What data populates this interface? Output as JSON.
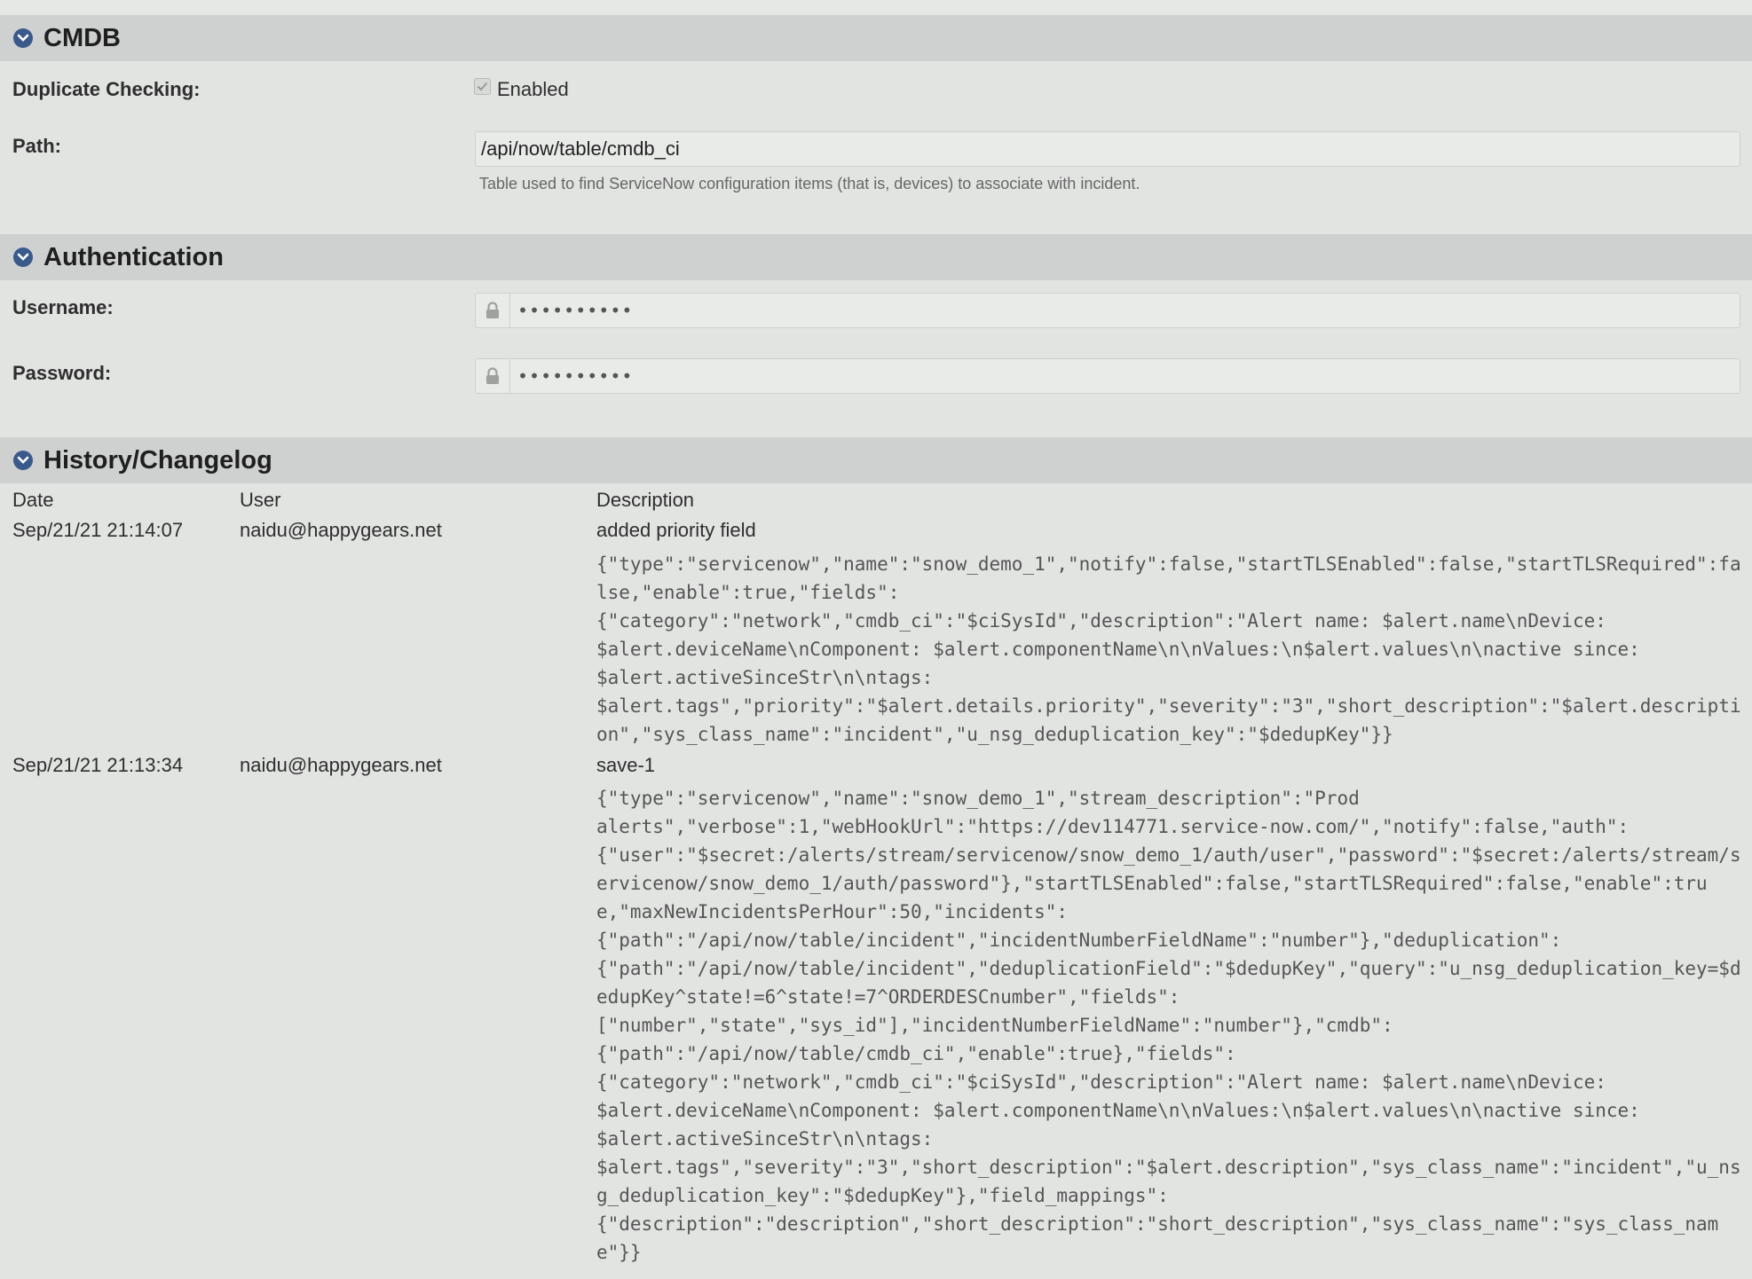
{
  "cmdb": {
    "title": "CMDB",
    "duplicate_label": "Duplicate Checking:",
    "duplicate_value": "Enabled",
    "path_label": "Path:",
    "path_value": "/api/now/table/cmdb_ci",
    "path_help": "Table used to find ServiceNow configuration items (that is, devices) to associate with incident."
  },
  "auth": {
    "title": "Authentication",
    "username_label": "Username:",
    "username_value": "••••••••••",
    "password_label": "Password:",
    "password_value": "••••••••••"
  },
  "history": {
    "title": "History/Changelog",
    "columns": {
      "date": "Date",
      "user": "User",
      "description": "Description"
    },
    "rows": [
      {
        "date": "Sep/21/21 21:14:07",
        "user": "naidu@happygears.net",
        "summary": "added priority field",
        "json": "{\"type\":\"servicenow\",\"name\":\"snow_demo_1\",\"notify\":false,\"startTLSEnabled\":false,\"startTLSRequired\":false,\"enable\":true,\"fields\":\n{\"category\":\"network\",\"cmdb_ci\":\"$ciSysId\",\"description\":\"Alert name: $alert.name\\nDevice:\n$alert.deviceName\\nComponent: $alert.componentName\\n\\nValues:\\n$alert.values\\n\\nactive since:\n$alert.activeSinceStr\\n\\ntags:\n$alert.tags\",\"priority\":\"$alert.details.priority\",\"severity\":\"3\",\"short_description\":\"$alert.description\",\"sys_class_name\":\"incident\",\"u_nsg_deduplication_key\":\"$dedupKey\"}}"
      },
      {
        "date": "Sep/21/21 21:13:34",
        "user": "naidu@happygears.net",
        "summary": "save-1",
        "json": "{\"type\":\"servicenow\",\"name\":\"snow_demo_1\",\"stream_description\":\"Prod\nalerts\",\"verbose\":1,\"webHookUrl\":\"https://dev114771.service-now.com/\",\"notify\":false,\"auth\":\n{\"user\":\"$secret:/alerts/stream/servicenow/snow_demo_1/auth/user\",\"password\":\"$secret:/alerts/stream/servicenow/snow_demo_1/auth/password\"},\"startTLSEnabled\":false,\"startTLSRequired\":false,\"enable\":true,\"maxNewIncidentsPerHour\":50,\"incidents\":\n{\"path\":\"/api/now/table/incident\",\"incidentNumberFieldName\":\"number\"},\"deduplication\":\n{\"path\":\"/api/now/table/incident\",\"deduplicationField\":\"$dedupKey\",\"query\":\"u_nsg_deduplication_key=$dedupKey^state!=6^state!=7^ORDERDESCnumber\",\"fields\":\n[\"number\",\"state\",\"sys_id\"],\"incidentNumberFieldName\":\"number\"},\"cmdb\":\n{\"path\":\"/api/now/table/cmdb_ci\",\"enable\":true},\"fields\":\n{\"category\":\"network\",\"cmdb_ci\":\"$ciSysId\",\"description\":\"Alert name: $alert.name\\nDevice:\n$alert.deviceName\\nComponent: $alert.componentName\\n\\nValues:\\n$alert.values\\n\\nactive since:\n$alert.activeSinceStr\\n\\ntags:\n$alert.tags\",\"severity\":\"3\",\"short_description\":\"$alert.description\",\"sys_class_name\":\"incident\",\"u_nsg_deduplication_key\":\"$dedupKey\"},\"field_mappings\":\n{\"description\":\"description\",\"short_description\":\"short_description\",\"sys_class_name\":\"sys_class_name\"}}"
      }
    ]
  }
}
